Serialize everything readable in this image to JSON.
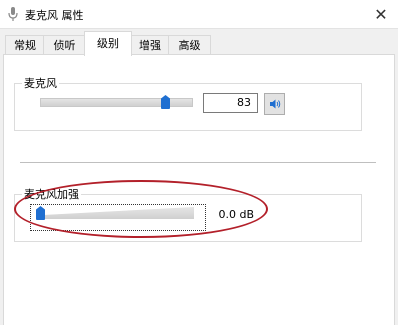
{
  "window": {
    "title": "麦克风 属性",
    "close_glyph": "✕",
    "icon": "microphone-icon"
  },
  "tabs": [
    {
      "label": "常规",
      "active": false
    },
    {
      "label": "侦听",
      "active": false
    },
    {
      "label": "级别",
      "active": true
    },
    {
      "label": "增强",
      "active": false
    },
    {
      "label": "高级",
      "active": false
    }
  ],
  "microphone": {
    "label": "麦克风",
    "level": 83,
    "value_text": "83",
    "mute_icon": "speaker-icon"
  },
  "boost": {
    "label": "麦克风加强",
    "value_text": "0.0 dB",
    "level_fraction": 0
  },
  "colors": {
    "accent": "#1f6fd1",
    "highlight_ellipse": "#b3202a"
  }
}
